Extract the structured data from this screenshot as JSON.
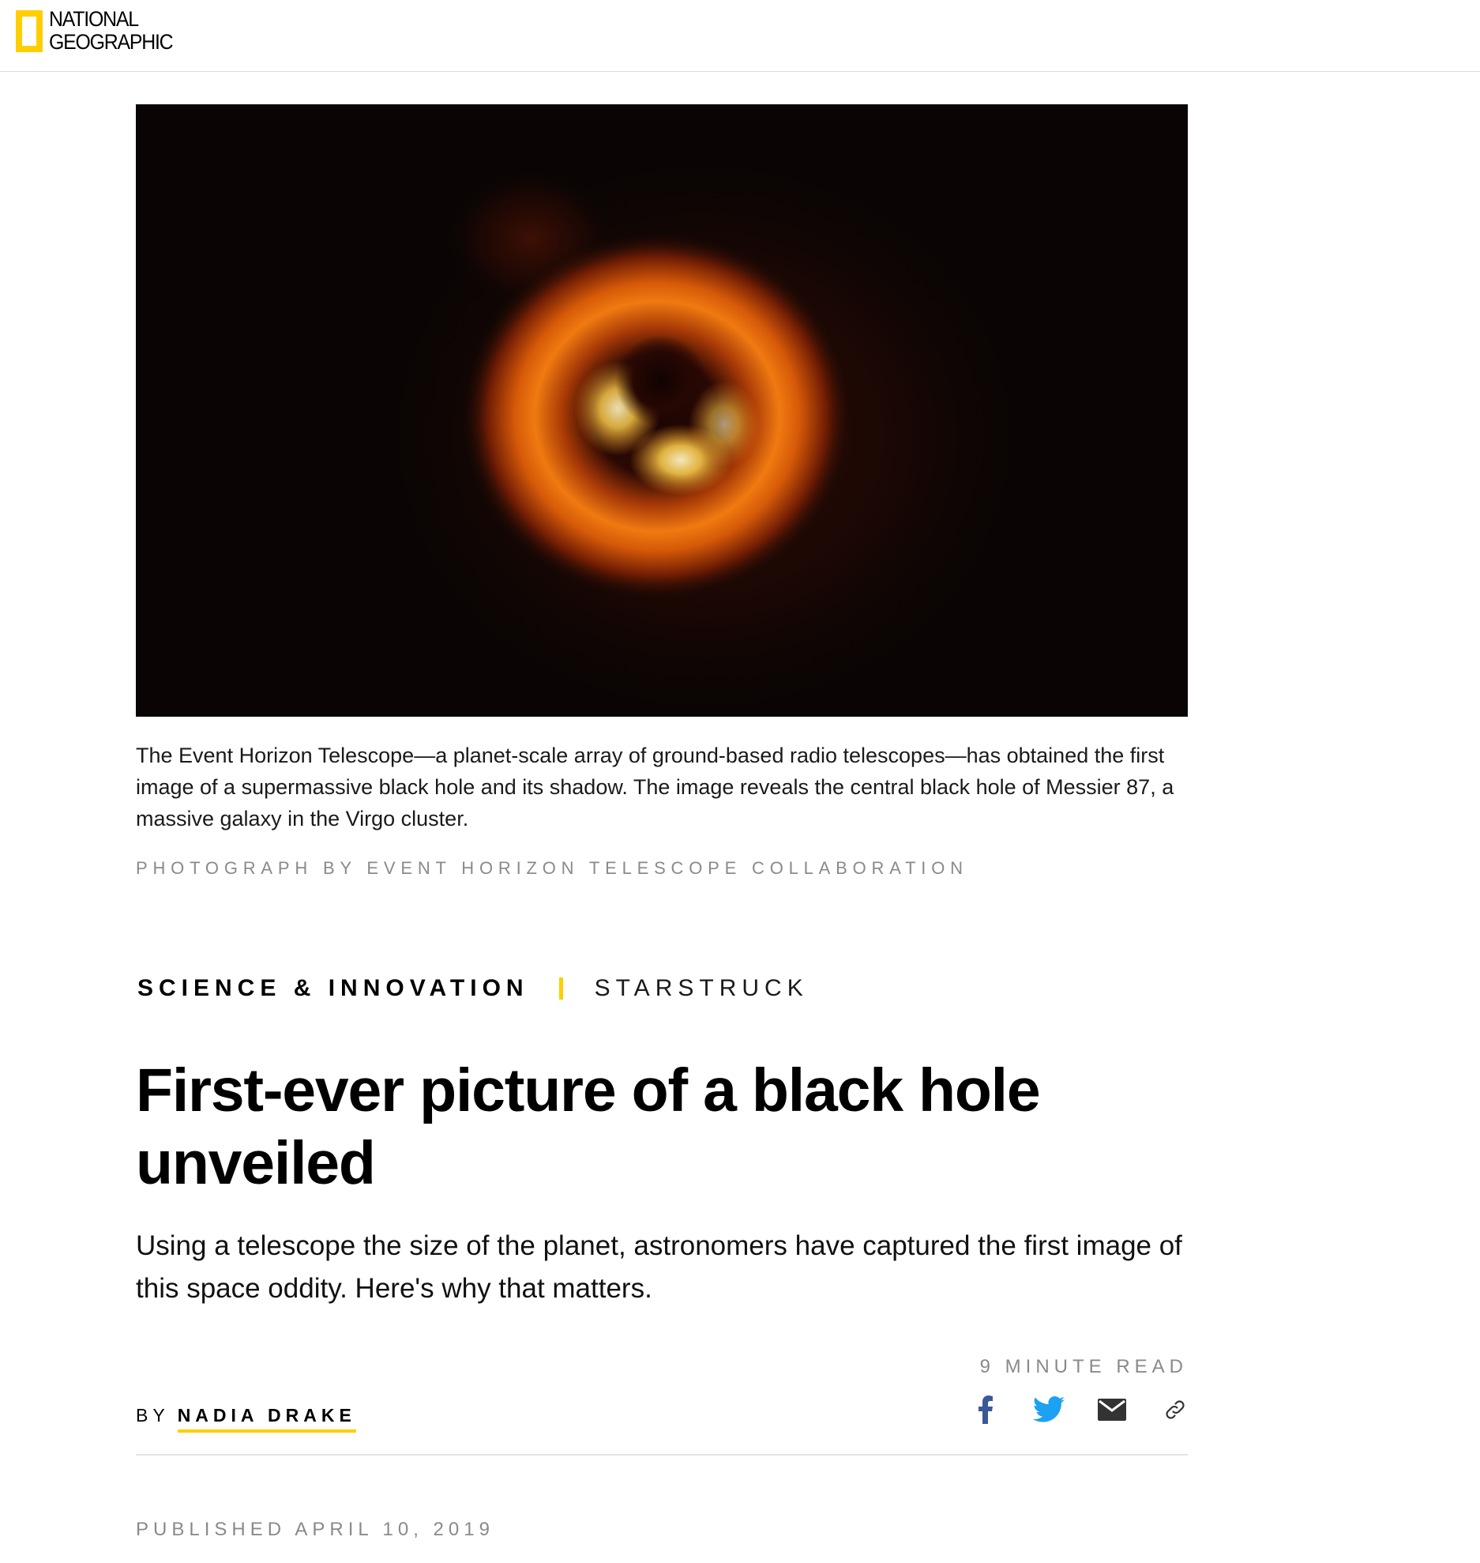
{
  "header": {
    "brand_line1": "NATIONAL",
    "brand_line2": "GEOGRAPHIC",
    "accent_color": "#ffce00"
  },
  "hero": {
    "description": "black-hole-image"
  },
  "caption": {
    "text": "The Event Horizon Telescope—a planet-scale array of ground-based radio telescopes—has obtained the first image of a supermassive black hole and its shadow. The image reveals the central black hole of Messier 87, a massive galaxy in the Virgo cluster.",
    "credit": "PHOTOGRAPH BY EVENT HORIZON TELESCOPE COLLABORATION"
  },
  "kicker": {
    "section": "SCIENCE & INNOVATION",
    "series": "STARSTRUCK"
  },
  "article": {
    "headline": "First-ever picture of a black hole unveiled",
    "dek": "Using a telescope the size of the planet, astronomers have captured the first image of this space oddity. Here's why that matters.",
    "read_time": "9 MINUTE READ",
    "byline_prefix": "BY",
    "author": "NADIA DRAKE",
    "published": "PUBLISHED APRIL 10, 2019"
  },
  "share": {
    "icons": [
      "facebook-icon",
      "twitter-icon",
      "email-icon",
      "link-icon"
    ],
    "facebook_color": "#3b5998",
    "twitter_color": "#1da1f2",
    "email_color": "#333333",
    "link_color": "#333333"
  }
}
